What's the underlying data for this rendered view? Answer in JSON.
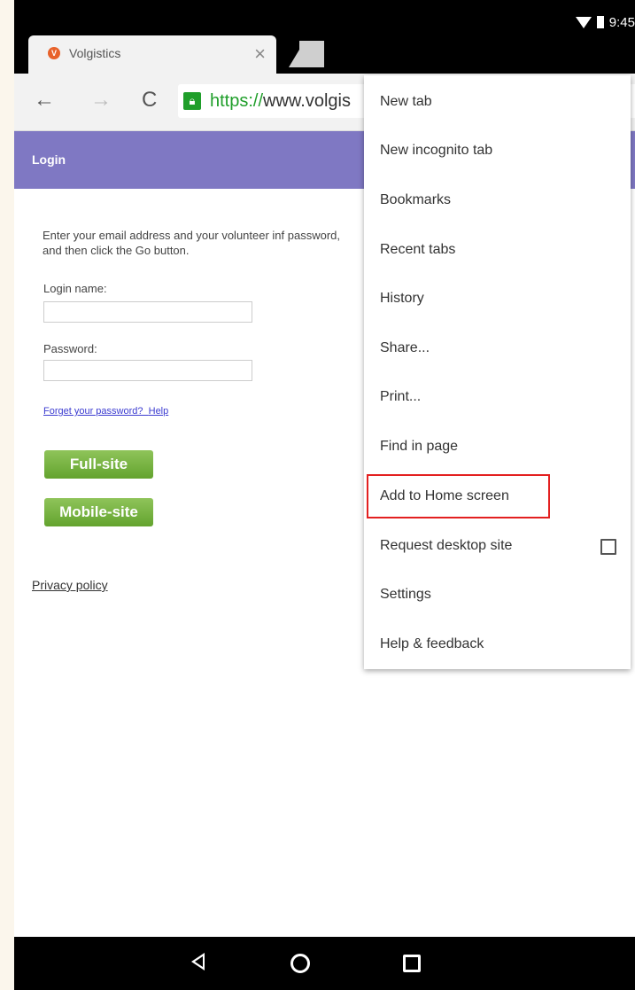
{
  "status": {
    "time": "9:45"
  },
  "tab": {
    "title": "Volgistics",
    "close_label": "×"
  },
  "toolbar": {
    "back_label": "←",
    "forward_label": "→",
    "reload_label": "C",
    "url_scheme": "https://",
    "url_rest": "www.volgis"
  },
  "page": {
    "header_title": "Login",
    "intro_text": "Enter your email address and your volunteer inf password, and then click the Go button.",
    "login_label": "Login name:",
    "password_label": "Password:",
    "forgot_link": "Forget your password?",
    "help_link": "Help",
    "full_site_button": "Full-site",
    "mobile_site_button": "Mobile-site",
    "privacy_link": "Privacy policy"
  },
  "menu": {
    "items": [
      {
        "label": "New tab"
      },
      {
        "label": "New incognito tab"
      },
      {
        "label": "Bookmarks"
      },
      {
        "label": "Recent tabs"
      },
      {
        "label": "History"
      },
      {
        "label": "Share..."
      },
      {
        "label": "Print..."
      },
      {
        "label": "Find in page"
      },
      {
        "label": "Add to Home screen",
        "highlighted": true
      },
      {
        "label": "Request desktop site",
        "checkbox": false
      },
      {
        "label": "Settings"
      },
      {
        "label": "Help & feedback"
      }
    ]
  },
  "colors": {
    "header_bg": "#7f78c3",
    "button_green": "#6fae3a",
    "highlight": "#e32020",
    "lock_green": "#1f9e2a"
  },
  "icons": [
    "wifi-icon",
    "battery-icon",
    "volgistics-favicon-icon",
    "lock-icon",
    "back-nav-icon",
    "home-nav-icon",
    "recents-nav-icon"
  ]
}
